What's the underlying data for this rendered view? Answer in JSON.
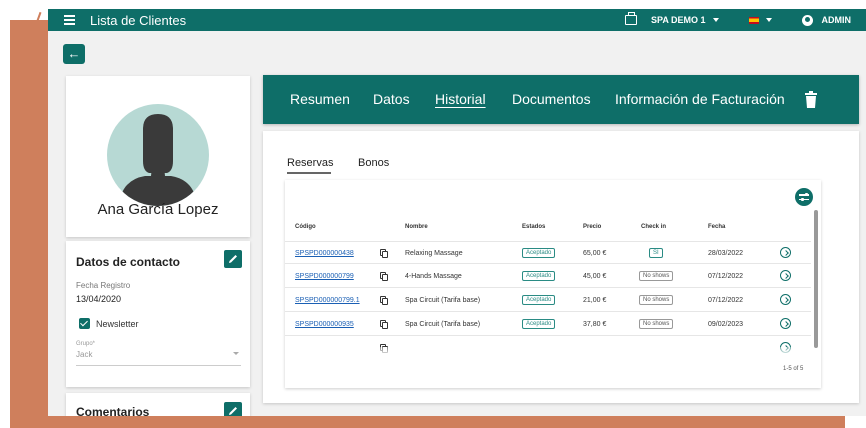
{
  "app": {
    "title": "Lista de Clientes",
    "spa_selector": "SPA DEMO 1",
    "user": "ADMIN"
  },
  "client": {
    "name": "Ana García Lopez"
  },
  "contact": {
    "title": "Datos de contacto",
    "registration_label": "Fecha Registro",
    "registration_value": "13/04/2020",
    "newsletter_label": "Newsletter",
    "newsletter_checked": true,
    "group_label": "Grupo*",
    "group_value": "Jack"
  },
  "comments": {
    "title": "Comentarios"
  },
  "tabs": [
    "Resumen",
    "Datos",
    "Historial",
    "Documentos",
    "Información de Facturación"
  ],
  "active_tab": "Historial",
  "subtabs": [
    "Reservas",
    "Bonos"
  ],
  "active_subtab": "Reservas",
  "table": {
    "columns": [
      "Código",
      "Nombre",
      "Estados",
      "Precio",
      "Check in",
      "Fecha"
    ],
    "rows": [
      {
        "code": "SPSPD000000438",
        "name": "Relaxing Massage",
        "status": "Aceptado",
        "price": "65,00 €",
        "checkin": "SI",
        "date": "28/03/2022"
      },
      {
        "code": "SPSPD000000799",
        "name": "4-Hands Massage",
        "status": "Aceptado",
        "price": "45,00 €",
        "checkin": "No shows",
        "date": "07/12/2022"
      },
      {
        "code": "SPSPD000000799.1",
        "name": "Spa Circuit (Tarifa base)",
        "status": "Aceptado",
        "price": "21,00 €",
        "checkin": "No shows",
        "date": "07/12/2022"
      },
      {
        "code": "SPSPD000000935",
        "name": "Spa Circuit (Tarifa base)",
        "status": "Aceptado",
        "price": "37,80 €",
        "checkin": "No shows",
        "date": "09/02/2023"
      }
    ],
    "pagination": "1-5 of 5"
  },
  "colors": {
    "primary": "#0e6e68",
    "frame": "#cf7f5c"
  }
}
